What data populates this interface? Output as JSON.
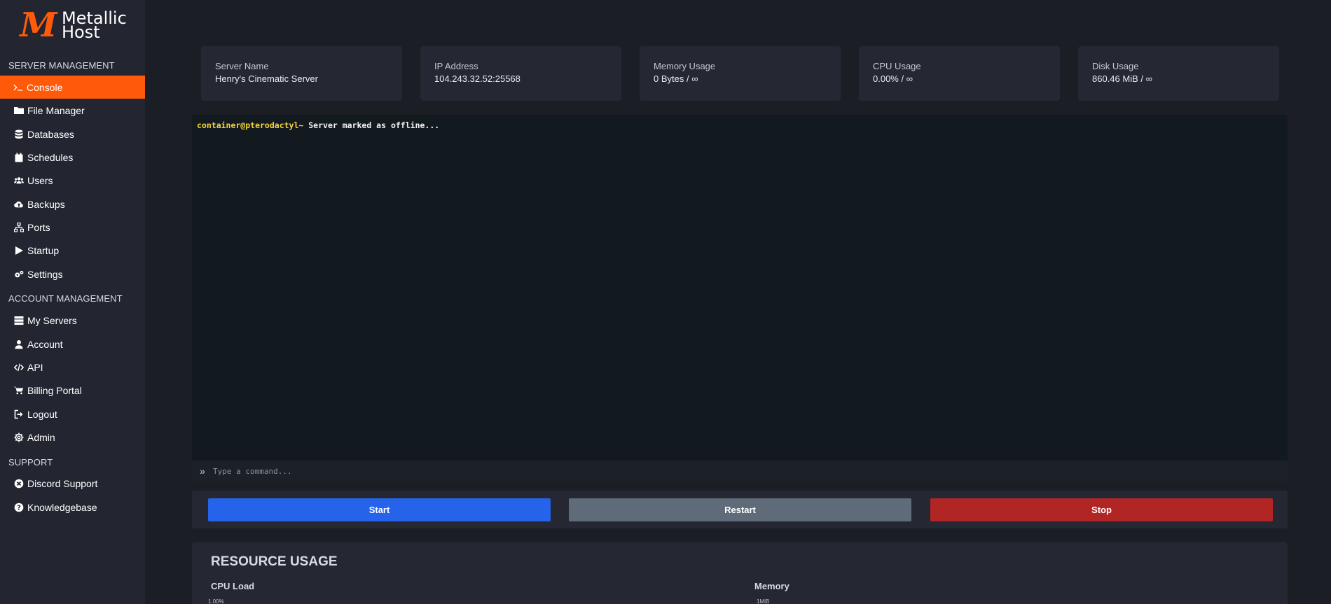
{
  "brand": {
    "mark": "M",
    "line1": "Metallic",
    "line2": "Host",
    "accent": "#ff5a0a"
  },
  "sidebar": {
    "sections": [
      {
        "title": "SERVER MANAGEMENT"
      },
      {
        "title": "ACCOUNT MANAGEMENT"
      },
      {
        "title": "SUPPORT"
      }
    ],
    "server_items": [
      {
        "label": "Console",
        "icon": "terminal-icon",
        "active": true
      },
      {
        "label": "File Manager",
        "icon": "folder-icon"
      },
      {
        "label": "Databases",
        "icon": "database-icon"
      },
      {
        "label": "Schedules",
        "icon": "calendar-icon"
      },
      {
        "label": "Users",
        "icon": "users-icon"
      },
      {
        "label": "Backups",
        "icon": "cloud-upload-icon"
      },
      {
        "label": "Ports",
        "icon": "network-icon"
      },
      {
        "label": "Startup",
        "icon": "play-icon"
      },
      {
        "label": "Settings",
        "icon": "cogs-icon"
      }
    ],
    "account_items": [
      {
        "label": "My Servers",
        "icon": "server-list-icon"
      },
      {
        "label": "Account",
        "icon": "user-icon"
      },
      {
        "label": "API",
        "icon": "code-icon"
      },
      {
        "label": "Billing Portal",
        "icon": "cart-icon"
      },
      {
        "label": "Logout",
        "icon": "sign-out-icon"
      },
      {
        "label": "Admin",
        "icon": "gear-icon"
      }
    ],
    "support_items": [
      {
        "label": "Discord Support",
        "icon": "discord-icon"
      },
      {
        "label": "Knowledgebase",
        "icon": "question-circle-icon"
      }
    ]
  },
  "stats": [
    {
      "label": "Server Name",
      "value": "Henry's Cinematic Server"
    },
    {
      "label": "IP Address",
      "value": "104.243.32.52:25568"
    },
    {
      "label": "Memory Usage",
      "value": "0 Bytes / ∞"
    },
    {
      "label": "CPU Usage",
      "value": "0.00% / ∞"
    },
    {
      "label": "Disk Usage",
      "value": "860.46 MiB / ∞"
    }
  ],
  "console": {
    "prompt": "container@pterodactyl~",
    "message": " Server marked as offline...",
    "input_placeholder": "Type a command..."
  },
  "controls": {
    "start": "Start",
    "restart": "Restart",
    "stop": "Stop",
    "colors": {
      "start": "#2563eb",
      "restart": "#5f6b78",
      "stop": "#b22525"
    }
  },
  "resource_usage": {
    "title": "RESOURCE USAGE",
    "cpu_label": "CPU Load",
    "cpu_axis_top": "1.00%",
    "memory_label": "Memory",
    "memory_axis_top": "1MiB"
  }
}
